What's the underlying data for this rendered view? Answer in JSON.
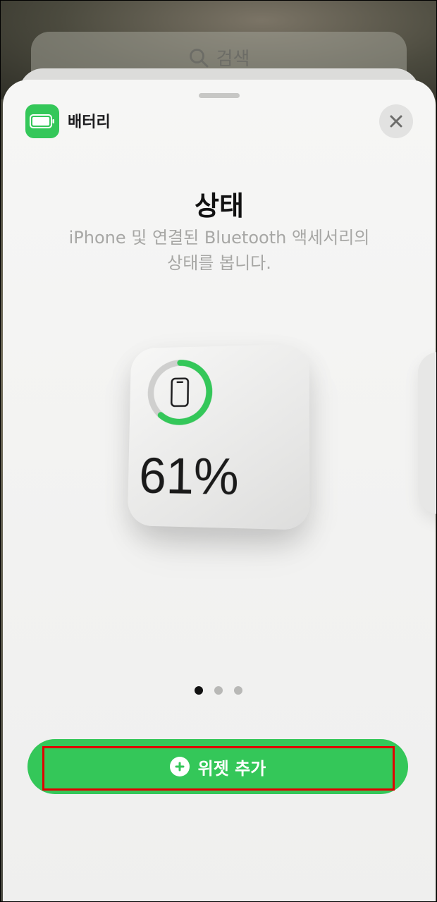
{
  "search": {
    "placeholder": "검색",
    "icon": "search-icon"
  },
  "sheet": {
    "app_name": "배터리",
    "app_icon": "battery-icon",
    "close_icon": "close-icon",
    "title": "상태",
    "subtitle_line1": "iPhone 및 연결된 Bluetooth 액세서리의",
    "subtitle_line2": "상태를 봅니다."
  },
  "widget": {
    "device_icon": "iphone-icon",
    "battery_level": 0.61,
    "percent_text": "61%"
  },
  "pager": {
    "page_count": 3,
    "current_page": 1
  },
  "add_button": {
    "label": "위젯 추가",
    "icon": "plus-circle-icon"
  },
  "colors": {
    "accent": "#34c759",
    "highlight": "#e00000"
  }
}
